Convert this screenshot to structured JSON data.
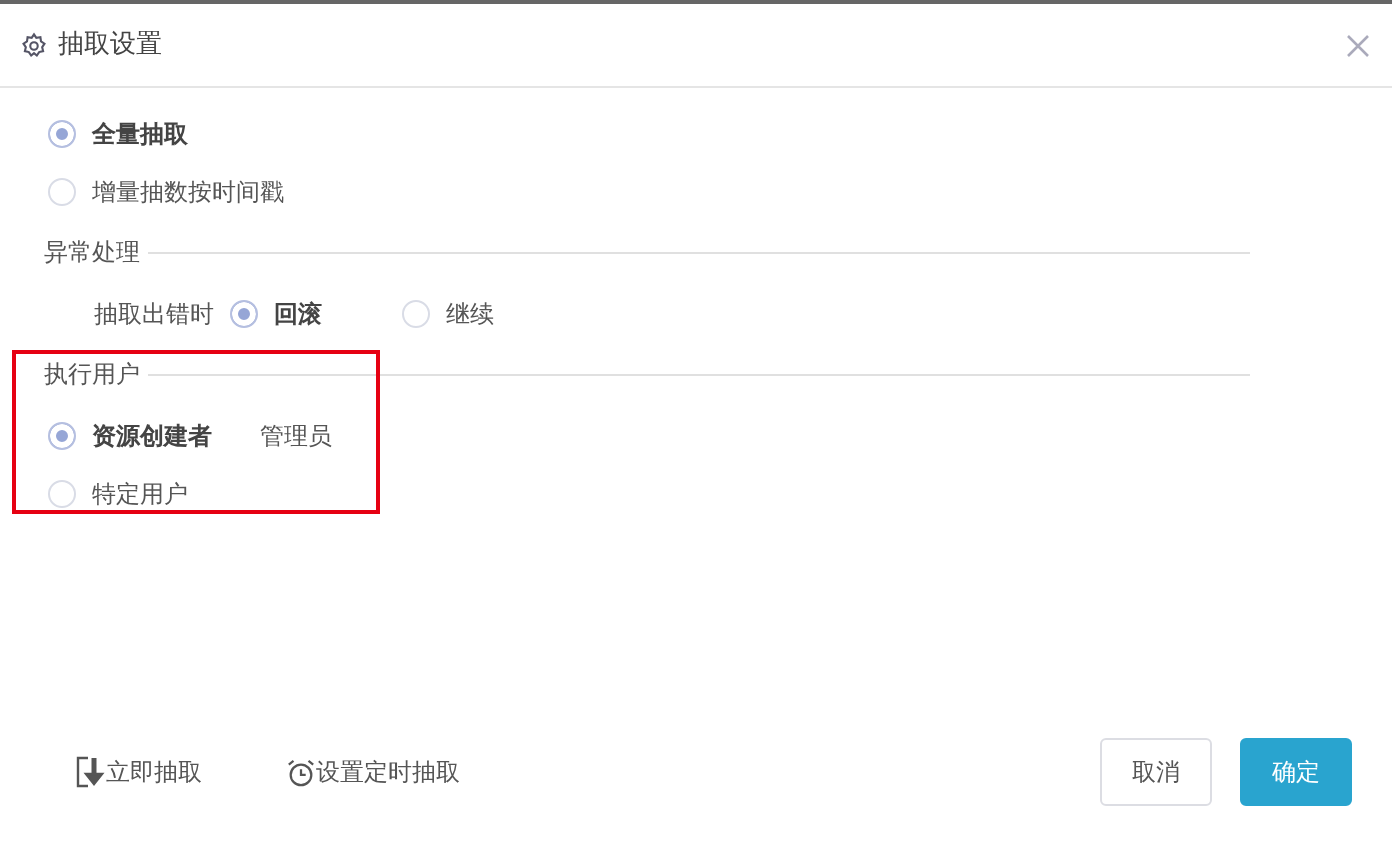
{
  "dialog": {
    "title": "抽取设置"
  },
  "extract_mode": [
    {
      "label": "全量抽取",
      "selected": true
    },
    {
      "label": "增量抽数按时间戳",
      "selected": false
    }
  ],
  "error_section": {
    "title": "异常处理",
    "field_label": "抽取出错时",
    "options": [
      {
        "label": "回滚",
        "selected": true
      },
      {
        "label": "继续",
        "selected": false
      }
    ]
  },
  "user_section": {
    "title": "执行用户",
    "highlighted": true,
    "options": [
      {
        "label": "资源创建者",
        "selected": true,
        "value": "管理员"
      },
      {
        "label": "特定用户",
        "selected": false
      }
    ]
  },
  "footer_links": [
    {
      "label": "立即抽取",
      "kind": "download"
    },
    {
      "label": "设置定时抽取",
      "kind": "alarm"
    }
  ],
  "buttons": [
    {
      "label": "取消",
      "kind": "secondary"
    },
    {
      "label": "确定",
      "kind": "primary"
    }
  ]
}
